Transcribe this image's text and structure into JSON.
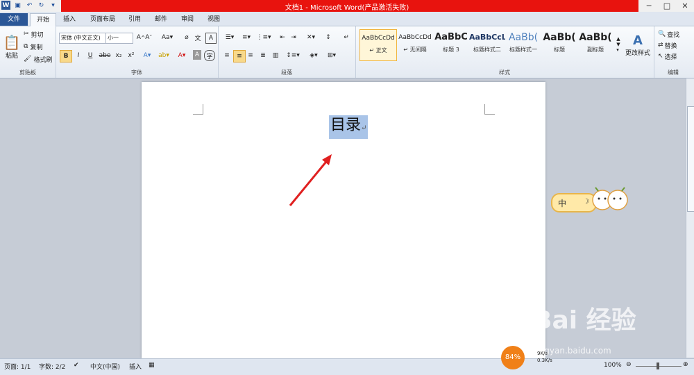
{
  "window": {
    "title": "文档1 - Microsoft Word(产品激活失败)",
    "controls": [
      "─",
      "□",
      "✕"
    ]
  },
  "tabs": [
    {
      "label": "文件"
    },
    {
      "label": "开始"
    },
    {
      "label": "插入"
    },
    {
      "label": "页面布局"
    },
    {
      "label": "引用"
    },
    {
      "label": "邮件"
    },
    {
      "label": "审阅"
    },
    {
      "label": "视图"
    }
  ],
  "clipboard": {
    "paste": "粘贴",
    "cut": "剪切",
    "copy": "复制",
    "format_painter": "格式刷",
    "group_label": "剪贴板"
  },
  "font": {
    "family": "宋体 (中文正文)",
    "size": "小一",
    "bold": "B",
    "italic": "I",
    "underline": "U",
    "strike": "abe",
    "subscript": "x₂",
    "superscript": "x²",
    "group_label": "字体"
  },
  "paragraph": {
    "group_label": "段落"
  },
  "styles": {
    "items": [
      {
        "preview": "AaBbCcDd",
        "label": "↵ 正文"
      },
      {
        "preview": "AaBbCcDd",
        "label": "↵ 无间隔"
      },
      {
        "preview": "AaBbC",
        "label": "标题 3"
      },
      {
        "preview": "AaBbCcL",
        "label": "标题样式二"
      },
      {
        "preview": "AaBb(",
        "label": "标题样式一"
      },
      {
        "preview": "AaBb(",
        "label": "标题"
      },
      {
        "preview": "AaBb(",
        "label": "副标题"
      }
    ],
    "change_styles": "更改样式",
    "group_label": "样式"
  },
  "editing": {
    "find": "查找",
    "replace": "替换",
    "select": "选择",
    "group_label": "编辑"
  },
  "document": {
    "heading": "目录",
    "paragraph_mark": "↵"
  },
  "status": {
    "page": "页面: 1/1",
    "words": "字数: 2/2",
    "language": "中文(中国)",
    "mode": "插入",
    "zoom": "100%"
  },
  "overlay": {
    "ime_char": "中",
    "cpu_badge": "84%",
    "net_up": "9K/s",
    "net_down": "0.3K/s",
    "watermark": "Bai 经验",
    "watermark_url": "jingyan.baidu.com"
  },
  "colors": {
    "title_bar": "#e8130e",
    "file_tab": "#2b5797",
    "selection": "#a9c4e8",
    "arrow": "#e02020"
  }
}
